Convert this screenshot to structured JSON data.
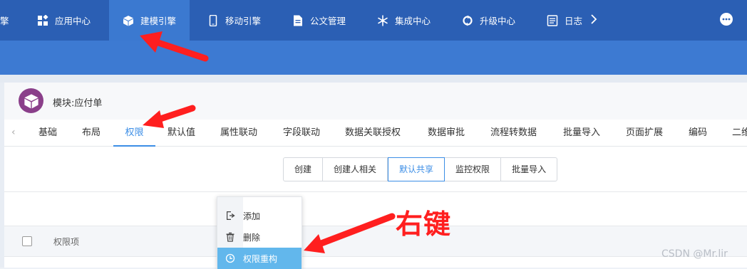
{
  "topnav": {
    "items": [
      {
        "label": "擎",
        "icon": "engine-icon"
      },
      {
        "label": "应用中心",
        "icon": "apps-icon"
      },
      {
        "label": "建模引擎",
        "icon": "cube-icon"
      },
      {
        "label": "移动引擎",
        "icon": "phone-icon"
      },
      {
        "label": "公文管理",
        "icon": "document-icon"
      },
      {
        "label": "集成中心",
        "icon": "snowflake-icon"
      },
      {
        "label": "升级中心",
        "icon": "cycle-icon"
      },
      {
        "label": "日志",
        "icon": "log-icon"
      }
    ],
    "active_index": 2,
    "more_icon": "chevron-right-icon",
    "menu_icon": "ellipsis-icon"
  },
  "module": {
    "title": "模块:应付单",
    "icon": "cube-icon"
  },
  "tabs": {
    "items": [
      "基础",
      "布局",
      "权限",
      "默认值",
      "属性联动",
      "字段联动",
      "数据关联授权",
      "数据审批",
      "流程转数据",
      "批量导入",
      "页面扩展",
      "编码",
      "二维"
    ],
    "active_index": 2,
    "prev_icon": "chevron-left-icon"
  },
  "subtabs": {
    "items": [
      "创建",
      "创建人相关",
      "默认共享",
      "监控权限",
      "批量导入"
    ],
    "selected_index": 2
  },
  "table": {
    "column_header": "权限项"
  },
  "context_menu": {
    "items": [
      {
        "label": "添加",
        "icon": "add-file-icon"
      },
      {
        "label": "删除",
        "icon": "trash-icon"
      },
      {
        "label": "权限重构",
        "icon": "clock-icon"
      }
    ],
    "highlighted_index": 2
  },
  "annotation": {
    "label": "右键",
    "color": "#ff1f1f"
  },
  "watermark": "CSDN @Mr.lir",
  "colors": {
    "topnav_bg": "#2b5fb4",
    "accent": "#3c8ee6",
    "menu_highlight": "#62b7ec"
  }
}
